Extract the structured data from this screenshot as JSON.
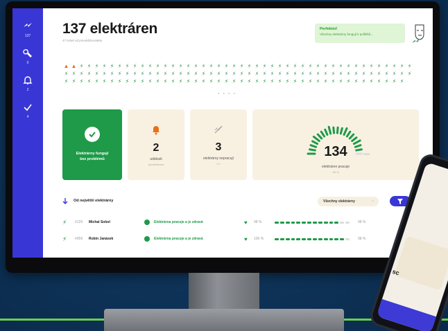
{
  "header": {
    "title": "137 elektráren",
    "subtitle": "47 ticket od prevádzkovatela"
  },
  "toast": {
    "title": "Perfektní!",
    "message": "Všechny elektrárny fungují k polštíků..."
  },
  "sidebar": {
    "items": [
      {
        "icon": "bolt-icon",
        "count": "137"
      },
      {
        "icon": "wrench-icon",
        "count": "0"
      },
      {
        "icon": "bell-icon",
        "count": "2"
      },
      {
        "icon": "check-icon",
        "count": "4"
      }
    ]
  },
  "plants": {
    "warning_count": 2,
    "total": 137,
    "pager": "● ● ● ●"
  },
  "cards": {
    "ok_label_1": "Elektrárny fungují",
    "ok_label_2": "bez problémů",
    "events_value": "2",
    "events_label": "události",
    "events_sub": "předmětnost",
    "broken_value": "3",
    "broken_label": "elektrárny nepracují",
    "broken_sub": "2 h",
    "running_value": "134",
    "running_max": "1000",
    "running_label": "elektráren pracuje",
    "running_sub": "98 %",
    "running_fraction": 0.98
  },
  "sort": {
    "label": "Od největší elektrárny",
    "filter_label": "Všechny elektrárny",
    "filter_clear": "×"
  },
  "rows": [
    {
      "id": "#129",
      "name": "Michal Sobol",
      "status": "Elektrárna pracuje a je zdravá",
      "health": "98 %",
      "production": "98 %",
      "fraction": 0.92
    },
    {
      "id": "#059",
      "name": "Robin Janásek",
      "status": "Elektrárna pracuje a je zdravá",
      "health": "100 %",
      "production": "98 %",
      "fraction": 0.96
    }
  ],
  "phone": {
    "text": "sc"
  },
  "colors": {
    "accent": "#3936d6",
    "success": "#1e9a48",
    "warning": "#e86f1a",
    "card_bg": "#f8f1e2"
  }
}
